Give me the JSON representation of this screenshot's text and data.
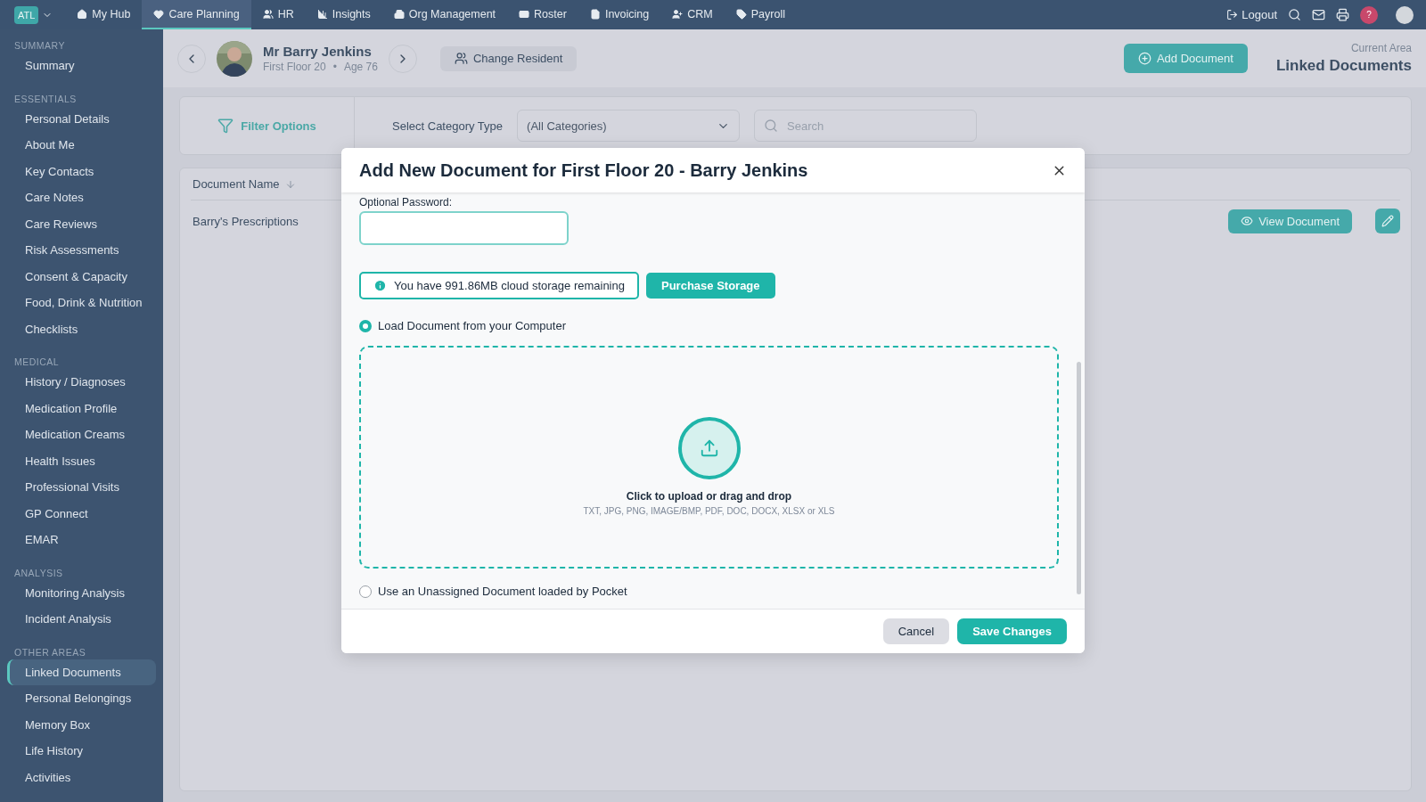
{
  "topnav": {
    "logo": "ATL",
    "items": [
      {
        "label": "My Hub",
        "selected": false
      },
      {
        "label": "Care Planning",
        "selected": true
      },
      {
        "label": "HR",
        "selected": false
      },
      {
        "label": "Insights",
        "selected": false
      },
      {
        "label": "Org Management",
        "selected": false
      },
      {
        "label": "Roster",
        "selected": false
      },
      {
        "label": "Invoicing",
        "selected": false
      },
      {
        "label": "CRM",
        "selected": false
      },
      {
        "label": "Payroll",
        "selected": false
      }
    ],
    "logout": "Logout",
    "help": "?"
  },
  "sidebar": {
    "sections": [
      {
        "heading": "SUMMARY",
        "items": [
          {
            "label": "Summary",
            "selected": false
          }
        ]
      },
      {
        "heading": "ESSENTIALS",
        "items": [
          {
            "label": "Personal Details",
            "selected": false
          },
          {
            "label": "About Me",
            "selected": false
          },
          {
            "label": "Key Contacts",
            "selected": false
          },
          {
            "label": "Care Notes",
            "selected": false
          },
          {
            "label": "Care Reviews",
            "selected": false
          },
          {
            "label": "Risk Assessments",
            "selected": false
          },
          {
            "label": "Consent & Capacity",
            "selected": false
          },
          {
            "label": "Food, Drink & Nutrition",
            "selected": false
          },
          {
            "label": "Checklists",
            "selected": false
          }
        ]
      },
      {
        "heading": "MEDICAL",
        "items": [
          {
            "label": "History / Diagnoses",
            "selected": false
          },
          {
            "label": "Medication Profile",
            "selected": false
          },
          {
            "label": "Medication Creams",
            "selected": false
          },
          {
            "label": "Health Issues",
            "selected": false
          },
          {
            "label": "Professional Visits",
            "selected": false
          },
          {
            "label": "GP Connect",
            "selected": false
          },
          {
            "label": "EMAR",
            "selected": false
          }
        ]
      },
      {
        "heading": "ANALYSIS",
        "items": [
          {
            "label": "Monitoring Analysis",
            "selected": false
          },
          {
            "label": "Incident Analysis",
            "selected": false
          }
        ]
      },
      {
        "heading": "OTHER AREAS",
        "items": [
          {
            "label": "Linked Documents",
            "selected": true
          },
          {
            "label": "Personal Belongings",
            "selected": false
          },
          {
            "label": "Memory Box",
            "selected": false
          },
          {
            "label": "Life History",
            "selected": false
          },
          {
            "label": "Activities",
            "selected": false
          }
        ]
      }
    ]
  },
  "resident": {
    "name": "Mr Barry Jenkins",
    "location": "First Floor 20",
    "separator": "•",
    "age": "Age 76",
    "change_button": "Change Resident"
  },
  "header_actions": {
    "add_button": "Add Document",
    "area_caption": "Current Area",
    "area_title": "Linked Documents"
  },
  "filters": {
    "filter_button": "Filter Options",
    "category_label": "Select Category Type",
    "category_value": "(All Categories)",
    "search_placeholder": "Search"
  },
  "table": {
    "columns": [
      "Document Name"
    ],
    "rows": [
      {
        "name": "Barry's Prescriptions",
        "view_button": "View Document"
      }
    ]
  },
  "modal": {
    "title": "Add New Document for First Floor 20 - Barry Jenkins",
    "password_label": "Optional Password:",
    "storage_notice": "You have 991.86MB cloud storage remaining",
    "purchase_button": "Purchase Storage",
    "sources": [
      {
        "label": "Load Document from your Computer",
        "selected": true
      },
      {
        "label": "Use an Unassigned Document loaded by Pocket",
        "selected": false
      }
    ],
    "dropzone": {
      "title": "Click to upload or drag and drop",
      "formats": "TXT, JPG, PNG, IMAGE/BMP, PDF, DOC, DOCX, XLSX or XLS"
    },
    "cancel_button": "Cancel",
    "save_button": "Save Changes"
  }
}
